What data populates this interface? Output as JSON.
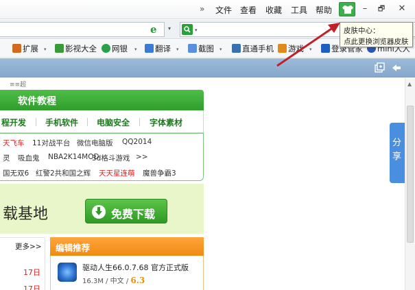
{
  "menu": {
    "chevron": "»",
    "items": [
      "文件",
      "查看",
      "收藏",
      "工具",
      "帮助"
    ],
    "controls": [
      "–",
      "🗗",
      "✕"
    ]
  },
  "search": {
    "dropdown": "▾"
  },
  "favorites": [
    {
      "label": "扩展",
      "color": "#d06a1e"
    },
    {
      "label": "影视大全",
      "color": "#3a9a3a"
    },
    {
      "label": "网银",
      "color": "#2aa04a"
    },
    {
      "label": "翻译",
      "color": "#3a7bd5"
    },
    {
      "label": "截图",
      "color": "#5b8fd9"
    },
    {
      "label": "直通手机",
      "color": "#3a6fb0"
    },
    {
      "label": "游戏",
      "color": "#e08a1a"
    },
    {
      "label": "登录管家",
      "color": "#1f5fbf"
    },
    {
      "label": "mini人人",
      "color": "#2a56b5"
    }
  ],
  "page": {
    "top_text": "≡≡超",
    "tutorial_title": "软件教程",
    "categories": [
      "程开发",
      "手机软件",
      "电脑安全",
      "字体素材"
    ],
    "links_row1": [
      {
        "text": "天飞车",
        "red": true
      },
      {
        "text": "11对战平台",
        "red": false
      },
      {
        "text": "微信电脑版",
        "red": false
      },
      {
        "text": "QQ2014",
        "red": false
      }
    ],
    "links_row2": [
      {
        "text": "灵",
        "red": false
      },
      {
        "text": "吸血鬼",
        "red": false
      },
      {
        "text": "NBA2K14MOD",
        "red": false
      },
      {
        "text": "3d格斗游戏",
        "red": false
      },
      {
        "text": ">>",
        "red": false
      }
    ],
    "links_row3": [
      {
        "text": "国无双6",
        "red": false
      },
      {
        "text": "红警2共和国之辉",
        "red": false
      },
      {
        "text": "天天星连萌",
        "red": true
      },
      {
        "text": "魔兽争霸3",
        "red": false
      }
    ],
    "banner_text": "载基地",
    "download_label": "免费下载",
    "more_label": "更多>>",
    "dates": [
      "17日",
      "17日"
    ],
    "editor_title": "编辑推荐",
    "app_title": "驱动人生66.0.7.68 官方正式版",
    "app_size": "16.3M",
    "app_sep": "/",
    "app_lang": "中文",
    "app_score": "6.3",
    "share_label": "分享"
  },
  "tooltip": {
    "line1": "皮肤中心：",
    "line2": "点此更换浏览器皮肤"
  },
  "colors": {
    "accent_green": "#3cb04a",
    "arrow_red": "#c0202a",
    "share_blue": "#4a8ee0",
    "editor_orange": "#f08a14"
  }
}
